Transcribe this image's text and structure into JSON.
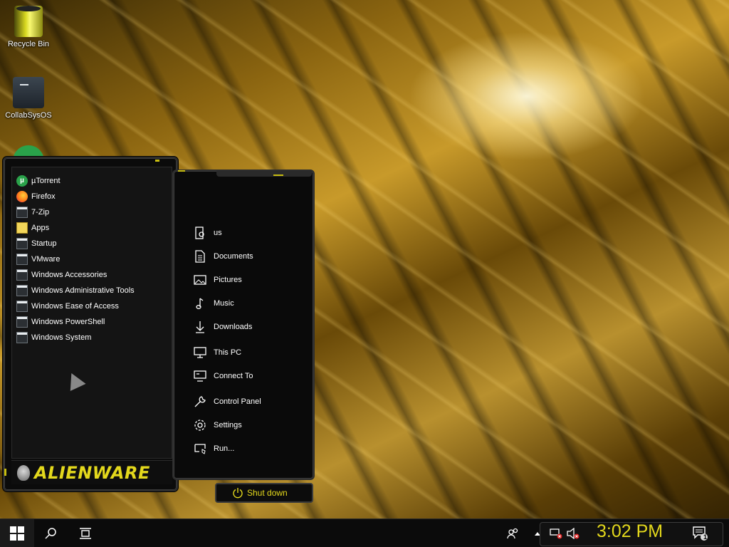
{
  "desktop": {
    "icons": [
      {
        "label": "Recycle Bin",
        "icon": "recycle-bin-icon"
      },
      {
        "label": "CollabSysOS",
        "icon": "folder-icon"
      }
    ]
  },
  "start_menu": {
    "apps": [
      {
        "label": "µTorrent",
        "icon": "utorrent-icon"
      },
      {
        "label": "Firefox",
        "icon": "firefox-icon"
      },
      {
        "label": "7-Zip",
        "icon": "folder-icon"
      },
      {
        "label": "Apps",
        "icon": "apps-icon"
      },
      {
        "label": "Startup",
        "icon": "folder-icon"
      },
      {
        "label": "VMware",
        "icon": "folder-icon"
      },
      {
        "label": "Windows Accessories",
        "icon": "folder-icon"
      },
      {
        "label": "Windows Administrative Tools",
        "icon": "folder-icon"
      },
      {
        "label": "Windows Ease of Access",
        "icon": "folder-icon"
      },
      {
        "label": "Windows PowerShell",
        "icon": "folder-icon"
      },
      {
        "label": "Windows System",
        "icon": "folder-icon"
      }
    ],
    "brand": "ALIENWARE",
    "places": [
      {
        "label": "us",
        "icon": "user-icon"
      },
      {
        "label": "Documents",
        "icon": "document-icon"
      },
      {
        "label": "Pictures",
        "icon": "picture-icon"
      },
      {
        "label": "Music",
        "icon": "music-icon"
      },
      {
        "label": "Downloads",
        "icon": "download-icon"
      },
      {
        "label": "This PC",
        "icon": "monitor-icon"
      },
      {
        "label": "Connect To",
        "icon": "connect-icon"
      },
      {
        "label": "Control Panel",
        "icon": "wrench-icon"
      },
      {
        "label": "Settings",
        "icon": "gear-icon"
      },
      {
        "label": "Run...",
        "icon": "run-icon"
      }
    ],
    "shutdown_label": "Shut down"
  },
  "taskbar": {
    "clock": "3:02 PM",
    "notification_count": "1",
    "accent_color": "#e3d81c"
  }
}
